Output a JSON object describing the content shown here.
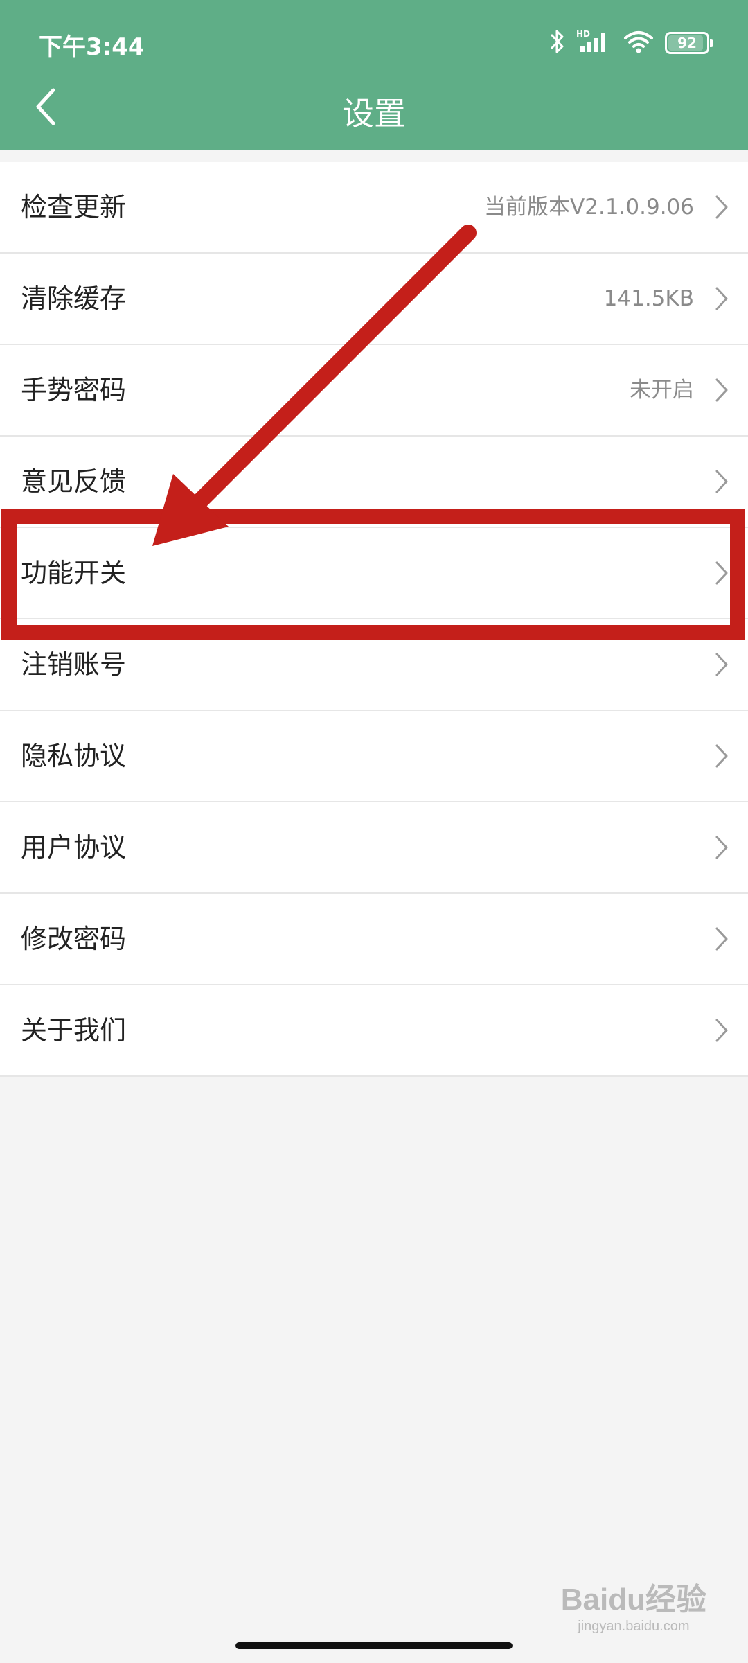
{
  "status_bar": {
    "time": "下午3:44",
    "battery": "92",
    "battery_level": 0.92,
    "icons": [
      "bluetooth-icon",
      "hd-signal-icon",
      "wifi-icon",
      "battery-icon"
    ]
  },
  "header": {
    "title": "设置",
    "back_icon": "chevron-left-icon",
    "color": "#5fae87"
  },
  "settings": {
    "items": [
      {
        "label": "检查更新",
        "value": "当前版本V2.1.0.9.06"
      },
      {
        "label": "清除缓存",
        "value": "141.5KB"
      },
      {
        "label": "手势密码",
        "value": "未开启"
      },
      {
        "label": "意见反馈",
        "value": ""
      },
      {
        "label": "功能开关",
        "value": ""
      },
      {
        "label": "注销账号",
        "value": ""
      },
      {
        "label": "隐私协议",
        "value": ""
      },
      {
        "label": "用户协议",
        "value": ""
      },
      {
        "label": "修改密码",
        "value": ""
      },
      {
        "label": "关于我们",
        "value": ""
      }
    ]
  },
  "annotation": {
    "color": "#c41f1a",
    "highlighted_item": "功能开关"
  },
  "watermark": {
    "main": "Baidu经验",
    "sub": "jingyan.baidu.com"
  }
}
